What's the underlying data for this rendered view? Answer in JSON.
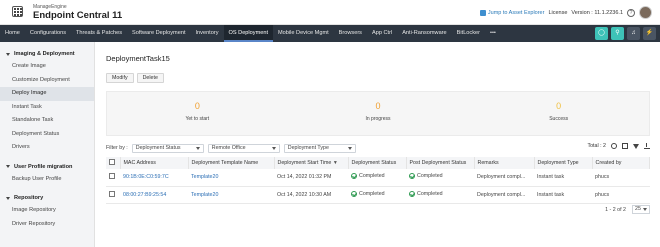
{
  "header": {
    "brand_small": "ManageEngine",
    "brand_title": "Endpoint Central 11",
    "jump_link": "Jump to Asset Explorer",
    "license": "License",
    "version": "Version : 11.1.2236.1",
    "help": "?"
  },
  "nav": {
    "tabs": [
      {
        "label": "Home"
      },
      {
        "label": "Configurations"
      },
      {
        "label": "Threats & Patches"
      },
      {
        "label": "Software Deployment"
      },
      {
        "label": "Inventory"
      },
      {
        "label": "OS Deployment"
      },
      {
        "label": "Mobile Device Mgmt"
      },
      {
        "label": "Browsers"
      },
      {
        "label": "App Ctrl"
      },
      {
        "label": "Anti-Ransomware"
      },
      {
        "label": "BitLocker"
      }
    ],
    "more": "•••",
    "right_icons": [
      "shield-icon",
      "search-icon",
      "bell-icon",
      "lightning-icon"
    ]
  },
  "sidebar": {
    "sections": [
      {
        "title": "Imaging & Deployment",
        "items": [
          "Create Image",
          "Customize Deployment",
          "Deploy Image",
          "Instant Task",
          "Standalone Task",
          "Deployment Status",
          "Drivers"
        ]
      },
      {
        "title": "User Profile migration",
        "items": [
          "Backup User Profile"
        ]
      },
      {
        "title": "Repository",
        "items": [
          "Image Repository",
          "Driver Repository"
        ]
      }
    ]
  },
  "main": {
    "title": "DeploymentTask15",
    "buttons": {
      "modify": "Modify",
      "delete": "Delete"
    },
    "stats": [
      {
        "value": "0",
        "label": "Yet to start",
        "color": "#f0a030"
      },
      {
        "value": "0",
        "label": "In progress",
        "color": "#f0a030"
      },
      {
        "value": "0",
        "label": "Success",
        "color": "#f0c040"
      }
    ],
    "filters": {
      "label": "Filter by :",
      "deployment_status": "Deployment Status",
      "remote_office": "Remote Office",
      "deployment_type": "Deployment Type"
    },
    "total": "Total : 2",
    "table": {
      "headers": [
        "MAC Address",
        "Deployment Template Name",
        "Deployment Start Time",
        "Deployment Status",
        "Post Deployment Status",
        "Remarks",
        "Deployment Type",
        "Created by"
      ],
      "rows": [
        {
          "mac": "90:1B:0E:C0:59:7C",
          "template": "Template20",
          "start": "Oct 14, 2022 01:32 PM",
          "status": "Completed",
          "post_status": "Completed",
          "remarks": "Deployment compl...",
          "type": "Instant task",
          "created_by": "phucs"
        },
        {
          "mac": "08:00:27:B9:25:54",
          "template": "Template20",
          "start": "Oct 14, 2022 10:30 AM",
          "status": "Completed",
          "post_status": "Completed",
          "remarks": "Deployment compl...",
          "type": "Instant task",
          "created_by": "phucs"
        }
      ]
    },
    "pager": {
      "range": "1 - 2 of 2",
      "page_size": "25"
    }
  },
  "colors": {
    "nav_bg": "#2d3641",
    "link": "#2c6fb5",
    "success": "#2f9a52"
  }
}
